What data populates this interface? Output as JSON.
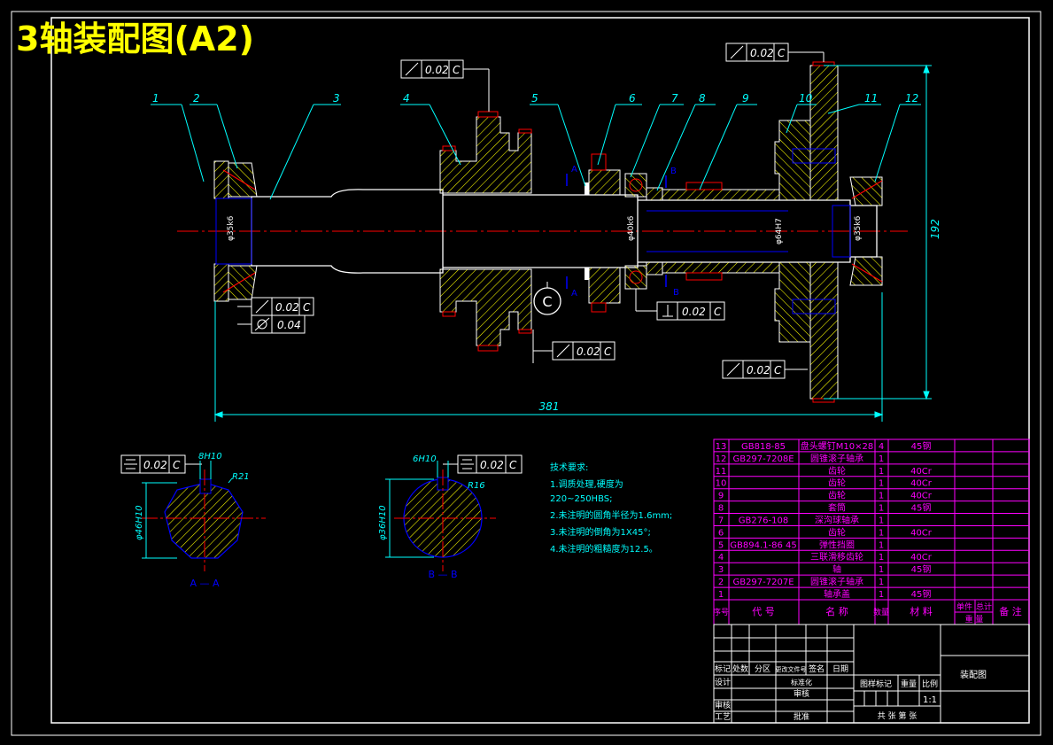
{
  "title": "3轴装配图(A2)",
  "colors": {
    "background": "#000000",
    "frame": "#ffffff",
    "title": "#ffff00",
    "part": "#ffffff",
    "hatch": "#ffff00",
    "dimension": "#00ffff",
    "centerline": "#ff0000",
    "detail": "#0000ff",
    "table": "#ff00ff"
  },
  "balloons": [
    "1",
    "2",
    "3",
    "4",
    "5",
    "6",
    "7",
    "8",
    "9",
    "10",
    "11",
    "12"
  ],
  "tolerances": {
    "t1": "0.02",
    "t1_datum": "C",
    "t2": "0.02",
    "t2_datum": "C",
    "t3": "0.02",
    "t3_datum": "C",
    "t4": "0.04",
    "t5": "0.02",
    "t5_datum": "C",
    "t6": "0.02",
    "t6_datum": "C",
    "t7": "0.02",
    "t7_datum": "C",
    "t8": "0.02",
    "t8_datum": "C",
    "t9": "0.02",
    "t9_datum": "C"
  },
  "dims": {
    "overall_length": "381",
    "height": "192",
    "fit_left": "φ35k6",
    "fit_mid": "φ40k6",
    "fit_gear": "φ64H7",
    "fit_right": "φ35k6",
    "section_a_dia": "φ46H10",
    "section_a_width": "8H10",
    "section_a_radius": "R21",
    "section_b_dia": "φ36H10",
    "section_b_width": "6H10",
    "section_b_radius": "R16"
  },
  "labels": {
    "datum_c": "C",
    "sec_a": "A",
    "sec_b": "B",
    "view_a": "A — A",
    "view_b": "B — B"
  },
  "tech_requirements": {
    "heading": "技术要求:",
    "lines": [
      "1.调质处理,硬度为",
      "220~250HBS;",
      "2.未注明的圆角半径为1.6mm;",
      "3.未注明的倒角为1X45°;",
      "4.未注明的粗糙度为12.5。"
    ]
  },
  "parts": [
    {
      "no": "13",
      "code": "GB818-85",
      "name": "盘头螺钉M10×28",
      "qty": "4",
      "material": "45钢",
      "tag": "part-row-13"
    },
    {
      "no": "12",
      "code": "GB297-7208E",
      "name": "圆锥滚子轴承",
      "qty": "1",
      "material": "",
      "tag": "part-row-12"
    },
    {
      "no": "11",
      "code": "",
      "name": "齿轮",
      "qty": "1",
      "material": "40Cr",
      "tag": "part-row-11"
    },
    {
      "no": "10",
      "code": "",
      "name": "齿轮",
      "qty": "1",
      "material": "40Cr",
      "tag": "part-row-10"
    },
    {
      "no": "9",
      "code": "",
      "name": "齿轮",
      "qty": "1",
      "material": "40Cr",
      "tag": "part-row-9"
    },
    {
      "no": "8",
      "code": "",
      "name": "套筒",
      "qty": "1",
      "material": "45钢",
      "tag": "part-row-8"
    },
    {
      "no": "7",
      "code": "GB276-108",
      "name": "深沟球轴承",
      "qty": "1",
      "material": "",
      "tag": "part-row-7"
    },
    {
      "no": "6",
      "code": "",
      "name": "齿轮",
      "qty": "1",
      "material": "40Cr",
      "tag": "part-row-6"
    },
    {
      "no": "5",
      "code": "GB894.1-86  45",
      "name": "弹性挡圈",
      "qty": "1",
      "material": "",
      "tag": "part-row-5"
    },
    {
      "no": "4",
      "code": "",
      "name": "三联滑移齿轮",
      "qty": "1",
      "material": "40Cr",
      "tag": "part-row-4"
    },
    {
      "no": "3",
      "code": "",
      "name": "轴",
      "qty": "1",
      "material": "45钢",
      "tag": "part-row-3"
    },
    {
      "no": "2",
      "code": "GB297-7207E",
      "name": "圆锥滚子轴承",
      "qty": "1",
      "material": "",
      "tag": "part-row-2"
    },
    {
      "no": "1",
      "code": "",
      "name": "轴承盖",
      "qty": "1",
      "material": "45钢",
      "tag": "part-row-1"
    }
  ],
  "parts_header": {
    "no": "序号",
    "code": "代  号",
    "name": "名  称",
    "qty": "数量",
    "material": "材  料",
    "unit_weight": "单件",
    "total_weight": "总计",
    "weight": "重  量",
    "note": "备  注"
  },
  "title_block": {
    "mark": "标记",
    "count": "处数",
    "zone": "分区",
    "doc_no": "更改文件号",
    "sign": "签名",
    "date": "日期",
    "design": "设计",
    "standardize": "标准化",
    "review": "审核",
    "process": "工艺",
    "approve": "批准",
    "stage_mark": "图样标记",
    "weight": "重量",
    "scale": "比例",
    "scale_value": "1:1",
    "sheets": "共    张  第    张",
    "drawing_name": "装配图"
  }
}
